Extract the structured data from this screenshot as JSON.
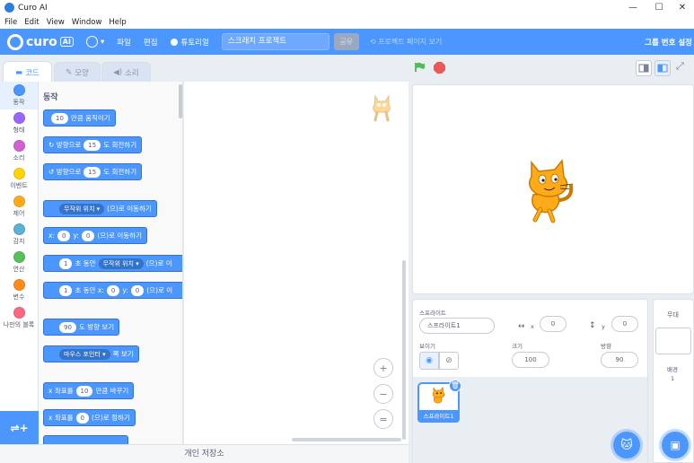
{
  "window": {
    "title": "Curo AI",
    "minimize": "—",
    "maximize": "☐",
    "close": "✕"
  },
  "menu": [
    "File",
    "Edit",
    "View",
    "Window",
    "Help"
  ],
  "appbar": {
    "brand": "curo",
    "brand_badge": "AI",
    "language_caret": "▾",
    "file": "파일",
    "edit": "편집",
    "tutorial": "튜토리얼",
    "project_title": "스크래치 프로젝트",
    "share": "공유",
    "project_page": "프로젝트 페이지 보기",
    "login": "그룹 번호 설정"
  },
  "tabs": {
    "code": "코드",
    "costumes": "모양",
    "sounds": "소리"
  },
  "categories": [
    {
      "label": "동작",
      "color": "#4c97ff"
    },
    {
      "label": "형태",
      "color": "#9966ff"
    },
    {
      "label": "소리",
      "color": "#cf63cf"
    },
    {
      "label": "이벤트",
      "color": "#ffd500"
    },
    {
      "label": "제어",
      "color": "#ffab19"
    },
    {
      "label": "감지",
      "color": "#5cb1d6"
    },
    {
      "label": "연산",
      "color": "#59c059"
    },
    {
      "label": "변수",
      "color": "#ff8c1a"
    },
    {
      "label": "나만의 블록",
      "color": "#ff6680"
    }
  ],
  "palette": {
    "heading": "동작",
    "move": {
      "value": "10",
      "text": "만큼 움직이기"
    },
    "turn_right": {
      "prefix": "방향으로",
      "value": "15",
      "text": "도 회전하기"
    },
    "turn_left": {
      "prefix": "방향으로",
      "value": "15",
      "text": "도 회전하기"
    },
    "goto": {
      "dropdown": "무작위 위치 ▾",
      "text": "(으)로 이동하기"
    },
    "goto_xy": {
      "x_label": "x:",
      "x": "0",
      "y_label": "y:",
      "y": "0",
      "text": "(으)로 이동하기"
    },
    "glide": {
      "secs": "1",
      "mid": "초 동안",
      "dropdown": "무작위 위치 ▾",
      "text": "(으)로 이"
    },
    "glide_xy": {
      "secs": "1",
      "mid": "초 동안 x:",
      "x": "0",
      "y_label": "y:",
      "y": "0",
      "text": "(으)로 이"
    },
    "point": {
      "value": "90",
      "text": "도 방향 보기"
    },
    "point_towards": {
      "dropdown": "마우스 포인터 ▾",
      "text": "쪽 보기"
    },
    "change_x": {
      "prefix": "x 좌표를",
      "value": "10",
      "text": "만큼 바꾸기"
    },
    "set_x": {
      "prefix": "x 좌표를",
      "value": "0",
      "text": "(으)로 정하기"
    }
  },
  "zoom": {
    "in": "+",
    "out": "−",
    "reset": "="
  },
  "backpack": "개인 저장소",
  "sprite": {
    "sprite_label": "스프라이트",
    "name": "스프라이트1",
    "x_label": "x",
    "x": "0",
    "y_label": "y",
    "y": "0",
    "show_label": "보이기",
    "size_label": "크기",
    "size": "100",
    "direction_label": "방향",
    "direction": "90",
    "thumb_name": "스프라이트1"
  },
  "stage_panel": {
    "title": "무대",
    "backdrops_label": "배경",
    "backdrops_count": "1"
  },
  "colors": {
    "accent": "#4c97ff",
    "stop": "#ec5959",
    "flag": "#4cbf56"
  }
}
